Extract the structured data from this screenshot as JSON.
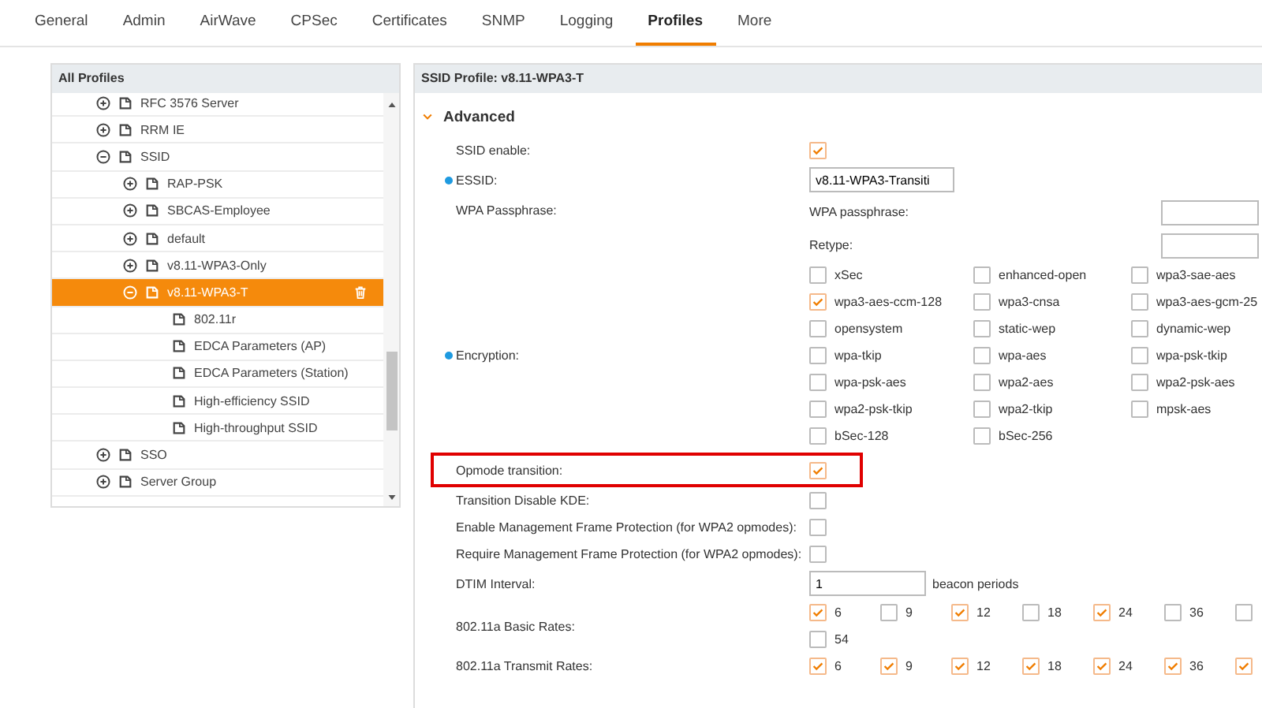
{
  "tabs": [
    {
      "label": "General",
      "selected": false
    },
    {
      "label": "Admin",
      "selected": false
    },
    {
      "label": "AirWave",
      "selected": false
    },
    {
      "label": "CPSec",
      "selected": false
    },
    {
      "label": "Certificates",
      "selected": false
    },
    {
      "label": "SNMP",
      "selected": false
    },
    {
      "label": "Logging",
      "selected": false
    },
    {
      "label": "Profiles",
      "selected": true
    },
    {
      "label": "More",
      "selected": false
    }
  ],
  "profiles": {
    "title": "All Profiles",
    "items": [
      {
        "label": "RFC 3576 Server",
        "expanded": false,
        "selected": false
      },
      {
        "label": "RRM IE",
        "expanded": false,
        "selected": false
      },
      {
        "label": "SSID",
        "expanded": true,
        "selected": false,
        "children": [
          {
            "label": "RAP-PSK",
            "expanded": false,
            "selected": false
          },
          {
            "label": "SBCAS-Employee",
            "expanded": false,
            "selected": false
          },
          {
            "label": "default",
            "expanded": false,
            "selected": false
          },
          {
            "label": "v8.11-WPA3-Only",
            "expanded": false,
            "selected": false
          },
          {
            "label": "v8.11-WPA3-T",
            "expanded": true,
            "selected": true,
            "children": [
              {
                "label": "802.11r",
                "selected": false
              },
              {
                "label": "EDCA Parameters (AP)",
                "selected": false
              },
              {
                "label": "EDCA Parameters (Station)",
                "selected": false
              },
              {
                "label": "High-efficiency SSID",
                "selected": false
              },
              {
                "label": "High-throughput SSID",
                "selected": false
              }
            ]
          }
        ]
      },
      {
        "label": "SSO",
        "expanded": false,
        "selected": false
      },
      {
        "label": "Server Group",
        "expanded": false,
        "selected": false
      }
    ]
  },
  "detail": {
    "title": "SSID Profile: v8.11-WPA3-T",
    "section": {
      "title": "Advanced",
      "expanded": true
    },
    "rows": [
      {
        "kind": "check",
        "label": "SSID enable:",
        "required": false,
        "checked": true,
        "highlighted": false
      },
      {
        "kind": "input",
        "label": "ESSID:",
        "required": true,
        "value": "v8.11-WPA3-Transiti"
      },
      {
        "kind": "passphrase",
        "label": "WPA Passphrase:",
        "required": false,
        "fields": [
          {
            "label": "WPA passphrase:"
          },
          {
            "label": "Retype:"
          }
        ]
      },
      {
        "kind": "checkgrid",
        "label": "Encryption:",
        "required": true,
        "options": [
          {
            "label": "xSec",
            "checked": false
          },
          {
            "label": "enhanced-open",
            "checked": false
          },
          {
            "label": "wpa3-sae-aes",
            "checked": false
          },
          {
            "label": "wpa3-aes-ccm-128",
            "checked": true
          },
          {
            "label": "wpa3-cnsa",
            "checked": false
          },
          {
            "label": "wpa3-aes-gcm-25",
            "checked": false
          },
          {
            "label": "opensystem",
            "checked": false
          },
          {
            "label": "static-wep",
            "checked": false
          },
          {
            "label": "dynamic-wep",
            "checked": false
          },
          {
            "label": "wpa-tkip",
            "checked": false
          },
          {
            "label": "wpa-aes",
            "checked": false
          },
          {
            "label": "wpa-psk-tkip",
            "checked": false
          },
          {
            "label": "wpa-psk-aes",
            "checked": false
          },
          {
            "label": "wpa2-aes",
            "checked": false
          },
          {
            "label": "wpa2-psk-aes",
            "checked": false
          },
          {
            "label": "wpa2-psk-tkip",
            "checked": false
          },
          {
            "label": "wpa2-tkip",
            "checked": false
          },
          {
            "label": "mpsk-aes",
            "checked": false
          },
          {
            "label": "bSec-128",
            "checked": false
          },
          {
            "label": "bSec-256",
            "checked": false
          }
        ]
      },
      {
        "kind": "check",
        "label": "Opmode transition:",
        "required": false,
        "checked": true,
        "highlighted": true
      },
      {
        "kind": "check",
        "label": "Transition Disable KDE:",
        "required": false,
        "checked": false,
        "highlighted": false
      },
      {
        "kind": "check",
        "label": "Enable Management Frame Protection (for WPA2 opmodes):",
        "required": false,
        "checked": false,
        "highlighted": false
      },
      {
        "kind": "check",
        "label": "Require Management Frame Protection (for WPA2 opmodes):",
        "required": false,
        "checked": false,
        "highlighted": false
      },
      {
        "kind": "input",
        "label": "DTIM Interval:",
        "required": false,
        "value": "1",
        "suffix": "beacon periods"
      },
      {
        "kind": "rates",
        "label": "802.11a Basic Rates:",
        "required": false,
        "options": [
          {
            "label": "6",
            "checked": true
          },
          {
            "label": "9",
            "checked": false
          },
          {
            "label": "12",
            "checked": true
          },
          {
            "label": "18",
            "checked": false
          },
          {
            "label": "24",
            "checked": true
          },
          {
            "label": "36",
            "checked": false
          },
          {
            "checked": false
          },
          {
            "label": "54",
            "checked": false
          }
        ]
      },
      {
        "kind": "rates",
        "label": "802.11a Transmit Rates:",
        "required": false,
        "options": [
          {
            "label": "6",
            "checked": true
          },
          {
            "label": "9",
            "checked": true
          },
          {
            "label": "12",
            "checked": true
          },
          {
            "label": "18",
            "checked": true
          },
          {
            "label": "24",
            "checked": true
          },
          {
            "label": "36",
            "checked": true
          },
          {
            "checked": true
          }
        ]
      }
    ]
  }
}
